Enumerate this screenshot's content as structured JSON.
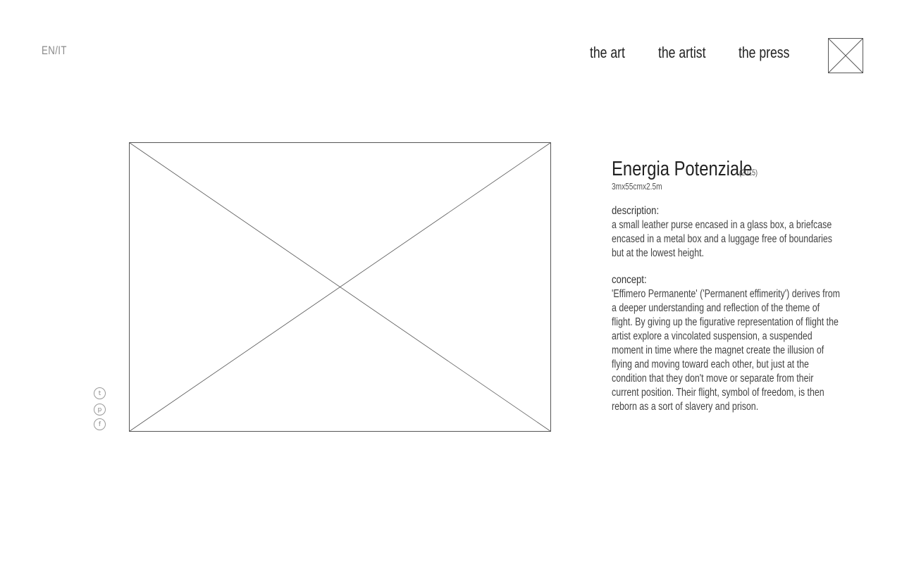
{
  "header": {
    "language_switch": "EN/IT",
    "nav": [
      {
        "label": "the art"
      },
      {
        "label": "the artist"
      },
      {
        "label": "the press"
      }
    ],
    "logo_icon": "logo-placeholder-icon"
  },
  "gallery": {
    "image_icon": "image-placeholder-icon",
    "social": [
      {
        "icon": "twitter-icon",
        "glyph": "t"
      },
      {
        "icon": "pinterest-icon",
        "glyph": "p"
      },
      {
        "icon": "facebook-icon",
        "glyph": "f"
      }
    ]
  },
  "artwork": {
    "title": "Energia Potenziale",
    "year": "(2015)",
    "dimensions": "3mx55cmx2.5m",
    "description_label": "description:",
    "description": "a small leather purse encased in a glass box, a briefcase encased in a metal box and a luggage free of boundaries but at the lowest height.",
    "concept_label": "concept:",
    "concept": "'Effimero Permanente' ('Permanent effimerity') derives from a deeper understanding and reflection of the theme of flight. By giving up  the figurative representation of flight the artist explore a vincolated suspension, a suspended moment in time where the magnet create the illusion of flying and moving toward each other, but just  at the condition that they don't move or separate from their current position. Their flight, symbol of freedom, is then reborn as a sort of slavery and prison."
  }
}
